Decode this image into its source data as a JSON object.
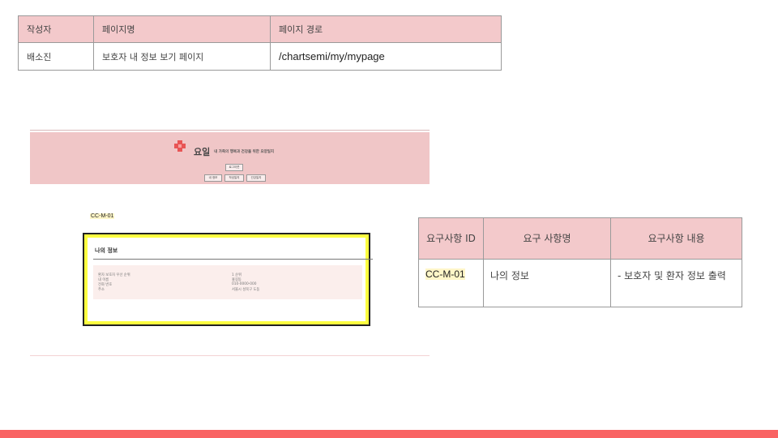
{
  "meta": {
    "headers": [
      "작성자",
      "페이지명",
      "페이지 경로"
    ],
    "values": [
      "배소진",
      "보호자 내 정보 보기 페이지",
      "/chartsemi/my/mypage"
    ]
  },
  "preview": {
    "logo_text": "요일",
    "tagline": "내 가족의 행복과 건강을 위한 요양일지",
    "logout_label": "로그아웃",
    "nav": [
      "내 정보",
      "작성일지",
      "건강일지"
    ],
    "myinfo_title": "나의 정보",
    "rows": [
      {
        "label": "환자 보호자 우선 순위",
        "value": "1 순위"
      },
      {
        "label": "내 이름",
        "value": "홍길동"
      },
      {
        "label": "전화 번호",
        "value": "010-0000-000"
      },
      {
        "label": "주소",
        "value": "서울시 성북구 도동"
      }
    ],
    "colors": {
      "header_bg": "#f0c6c7",
      "highlight": "#fdff40",
      "panel_bg": "#fbeeec"
    }
  },
  "requirement_tag": "CC-M-01",
  "requirements": {
    "headers": [
      "요구사항 ID",
      "요구 사항명",
      "요구사항 내용"
    ],
    "rows": [
      {
        "id": "CC-M-01",
        "name": "나의 정보",
        "content": "- 보호자 및 환자 정보 출력"
      }
    ]
  },
  "colors": {
    "table_header": "#f3c9cb",
    "footer": "#f96363",
    "id_highlight": "#fff6c8"
  }
}
